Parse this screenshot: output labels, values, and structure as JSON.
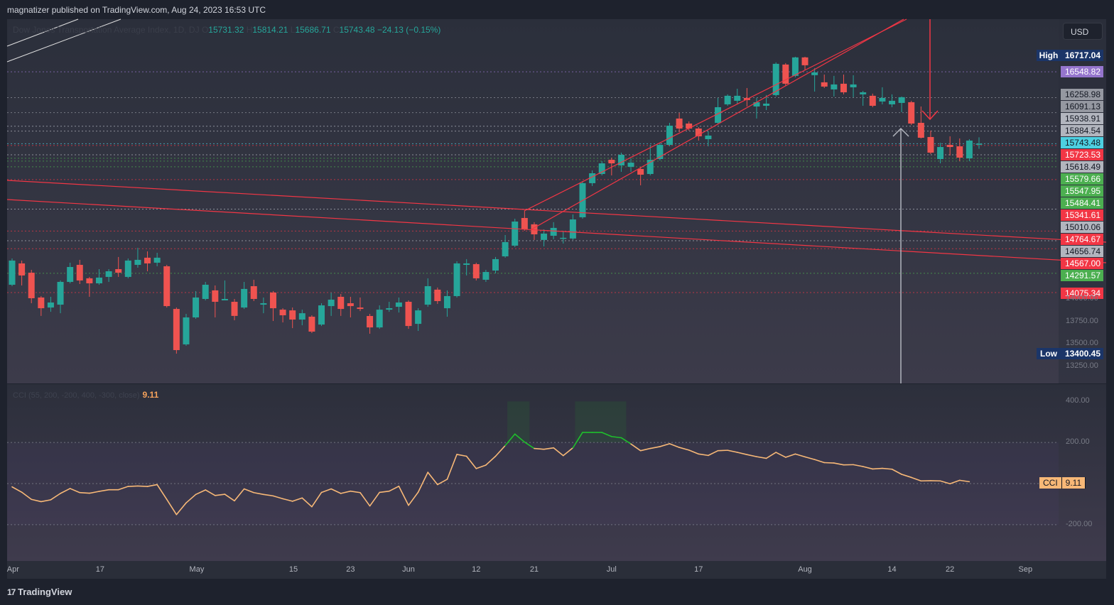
{
  "header": {
    "published": "magnatizer published on TradingView.com, Aug 24, 2023 16:53 UTC"
  },
  "legend": {
    "symbol": "Dow Jones Transportation Average Index, 1D, DJ",
    "o_label": "O",
    "o": "15731.32",
    "h_label": "H",
    "h": "15814.21",
    "l_label": "L",
    "l": "15686.71",
    "c_label": "C",
    "c": "15743.48",
    "change": "−24.13 (−0.15%)"
  },
  "currency": "USD",
  "footer": {
    "brand": "TradingView"
  },
  "colors": {
    "up": "#26a69a",
    "down": "#ef5350",
    "cci": "#f7b877",
    "cci_hi": "#1fbf2c",
    "trend": "#f23645"
  },
  "price_labels": [
    {
      "tag": "High",
      "value": "16717.04",
      "price": 16717.04,
      "bg": "#1b3568",
      "fg": "#ffffff"
    },
    {
      "value": "16548.82",
      "price": 16548.82,
      "bg": "#9575cd",
      "fg": "#ffffff"
    },
    {
      "value": "16258.98",
      "price": 16258.98,
      "bg": "#9598a1",
      "fg": "#131722"
    },
    {
      "value": "16091.13",
      "price": 16091.13,
      "bg": "#9598a1",
      "fg": "#131722"
    },
    {
      "value": "15938.91",
      "price": 15938.91,
      "bg": "#b2b5be",
      "fg": "#131722"
    },
    {
      "value": "15884.54",
      "price": 15884.54,
      "bg": "#b2b5be",
      "fg": "#131722"
    },
    {
      "value": "15743.48",
      "price": 15743.48,
      "bg": "#4dd0e1",
      "fg": "#131722"
    },
    {
      "value": "15723.53",
      "price": 15723.53,
      "bg": "#f23645",
      "fg": "#ffffff"
    },
    {
      "value": "15618.49",
      "price": 15618.49,
      "bg": "#b2b5be",
      "fg": "#131722"
    },
    {
      "value": "15579.66",
      "price": 15579.66,
      "bg": "#4caf50",
      "fg": "#ffffff"
    },
    {
      "value": "15547.95",
      "price": 15547.95,
      "bg": "#4caf50",
      "fg": "#ffffff"
    },
    {
      "value": "15484.41",
      "price": 15484.41,
      "bg": "#4caf50",
      "fg": "#ffffff"
    },
    {
      "value": "15341.61",
      "price": 15341.61,
      "bg": "#f23645",
      "fg": "#ffffff"
    },
    {
      "value": "15010.06",
      "price": 15010.06,
      "bg": "#b2b5be",
      "fg": "#131722"
    },
    {
      "value": "14764.67",
      "price": 14764.67,
      "bg": "#f23645",
      "fg": "#ffffff"
    },
    {
      "value": "14656.74",
      "price": 14656.74,
      "bg": "#b2b5be",
      "fg": "#131722"
    },
    {
      "value": "14567.00",
      "price": 14567.0,
      "bg": "#f23645",
      "fg": "#ffffff"
    },
    {
      "value": "14291.57",
      "price": 14291.57,
      "bg": "#4caf50",
      "fg": "#ffffff"
    },
    {
      "value": "14075.34",
      "price": 14075.34,
      "bg": "#f23645",
      "fg": "#ffffff"
    },
    {
      "tag": "Low",
      "value": "13400.45",
      "price": 13400.45,
      "bg": "#1b3568",
      "fg": "#ffffff"
    }
  ],
  "chart_data": {
    "type": "candlestick",
    "title": "Dow Jones Transportation Average Index, 1D, DJ",
    "price_axis_ticks": [
      "14000.00",
      "13750.00",
      "13500.00",
      "13250.00"
    ],
    "tick_prices": [
      14000,
      13750,
      13500,
      13250
    ],
    "x_ticks": [
      {
        "label": "Apr",
        "bar": 1.1
      },
      {
        "label": "17",
        "bar": 10.1
      },
      {
        "label": "May",
        "bar": 20.1
      },
      {
        "label": "15",
        "bar": 30.1
      },
      {
        "label": "23",
        "bar": 36
      },
      {
        "label": "Jun",
        "bar": 42
      },
      {
        "label": "12",
        "bar": 49
      },
      {
        "label": "21",
        "bar": 55
      },
      {
        "label": "Jul",
        "bar": 63
      },
      {
        "label": "17",
        "bar": 72
      },
      {
        "label": "Aug",
        "bar": 83
      },
      {
        "label": "14",
        "bar": 92
      },
      {
        "label": "22",
        "bar": 98
      },
      {
        "label": "Sep",
        "bar": 105.8
      }
    ],
    "ohlc": [
      [
        14163,
        14457,
        14147,
        14434
      ],
      [
        14402,
        14434,
        14155,
        14267
      ],
      [
        14298,
        14330,
        13956,
        14012
      ],
      [
        14020,
        14036,
        13814,
        13900
      ],
      [
        13908,
        14028,
        13860,
        13964
      ],
      [
        13940,
        14211,
        13844,
        14195
      ],
      [
        14195,
        14410,
        14179,
        14362
      ],
      [
        14386,
        14442,
        14171,
        14211
      ],
      [
        14235,
        14251,
        14028,
        14179
      ],
      [
        14179,
        14338,
        14163,
        14243
      ],
      [
        14251,
        14338,
        14195,
        14314
      ],
      [
        14338,
        14474,
        14251,
        14298
      ],
      [
        14251,
        14457,
        14235,
        14434
      ],
      [
        14386,
        14577,
        14354,
        14442
      ],
      [
        14466,
        14537,
        14314,
        14402
      ],
      [
        14410,
        14521,
        14370,
        14466
      ],
      [
        14370,
        14386,
        13908,
        13924
      ],
      [
        13892,
        13908,
        13391,
        13431
      ],
      [
        13495,
        13837,
        13479,
        13797
      ],
      [
        13797,
        14092,
        13781,
        14020
      ],
      [
        14004,
        14195,
        13988,
        14163
      ],
      [
        14100,
        14155,
        13797,
        13972
      ],
      [
        13988,
        14211,
        13988,
        14004
      ],
      [
        13972,
        14004,
        13765,
        13814
      ],
      [
        13908,
        14195,
        13892,
        14116
      ],
      [
        14147,
        14219,
        13980,
        14004
      ],
      [
        13940,
        14020,
        13844,
        13956
      ],
      [
        14076,
        14092,
        13757,
        13900
      ],
      [
        13884,
        13900,
        13741,
        13821
      ],
      [
        13876,
        13908,
        13677,
        13773
      ],
      [
        13773,
        13884,
        13709,
        13844
      ],
      [
        13805,
        13821,
        13622,
        13638
      ],
      [
        13717,
        13956,
        13701,
        13932
      ],
      [
        13924,
        14076,
        13814,
        13996
      ],
      [
        14028,
        14060,
        13814,
        13892
      ],
      [
        13956,
        14028,
        13797,
        13924
      ],
      [
        13908,
        14020,
        13868,
        13892
      ],
      [
        13813,
        13837,
        13614,
        13685
      ],
      [
        13685,
        13932,
        13669,
        13884
      ],
      [
        13884,
        13972,
        13860,
        13900
      ],
      [
        13916,
        14020,
        13852,
        13964
      ],
      [
        13972,
        13988,
        13669,
        13701
      ],
      [
        13725,
        13900,
        13646,
        13876
      ],
      [
        13940,
        14235,
        13916,
        14147
      ],
      [
        14108,
        14132,
        13948,
        13980
      ],
      [
        13900,
        14100,
        13805,
        14036
      ],
      [
        14036,
        14426,
        14020,
        14402
      ],
      [
        14386,
        14450,
        14267,
        14402
      ],
      [
        14394,
        14410,
        14211,
        14235
      ],
      [
        14219,
        14330,
        14195,
        14306
      ],
      [
        14322,
        14474,
        14290,
        14450
      ],
      [
        14481,
        14720,
        14466,
        14641
      ],
      [
        14601,
        14903,
        14585,
        14871
      ],
      [
        14911,
        14990,
        14768,
        14784
      ],
      [
        14840,
        14864,
        14665,
        14728
      ],
      [
        14665,
        14784,
        14593,
        14736
      ],
      [
        14712,
        14864,
        14673,
        14800
      ],
      [
        14681,
        14768,
        14625,
        14689
      ],
      [
        14681,
        14951,
        14665,
        14895
      ],
      [
        14919,
        15325,
        14903,
        15301
      ],
      [
        15301,
        15444,
        15269,
        15412
      ],
      [
        15404,
        15547,
        15388,
        15523
      ],
      [
        15563,
        15587,
        15388,
        15523
      ],
      [
        15500,
        15643,
        15428,
        15619
      ],
      [
        15484,
        15579,
        15428,
        15531
      ],
      [
        15460,
        15484,
        15277,
        15396
      ],
      [
        15404,
        15730,
        15388,
        15563
      ],
      [
        15571,
        15754,
        15555,
        15730
      ],
      [
        15730,
        15977,
        15714,
        15945
      ],
      [
        16025,
        16089,
        15874,
        15913
      ],
      [
        15969,
        15993,
        15890,
        15913
      ],
      [
        15913,
        15929,
        15778,
        15826
      ],
      [
        15794,
        15882,
        15714,
        15834
      ],
      [
        15977,
        16256,
        15961,
        16152
      ],
      [
        16184,
        16296,
        16168,
        16280
      ],
      [
        16224,
        16359,
        16184,
        16280
      ],
      [
        16256,
        16367,
        16160,
        16232
      ],
      [
        16160,
        16256,
        16025,
        16208
      ],
      [
        16168,
        16288,
        16120,
        16192
      ],
      [
        16288,
        16654,
        16272,
        16638
      ],
      [
        16630,
        16646,
        16391,
        16415
      ],
      [
        16503,
        16717,
        16487,
        16710
      ],
      [
        16710,
        16717,
        16566,
        16622
      ],
      [
        16511,
        16590,
        16327,
        16542
      ],
      [
        16431,
        16518,
        16367,
        16383
      ],
      [
        16351,
        16503,
        16272,
        16407
      ],
      [
        16415,
        16518,
        16296,
        16319
      ],
      [
        16375,
        16510,
        16264,
        16407
      ],
      [
        16296,
        16335,
        16168,
        16319
      ],
      [
        16280,
        16304,
        16152,
        16168
      ],
      [
        16216,
        16375,
        16184,
        16256
      ],
      [
        16184,
        16296,
        16152,
        16224
      ],
      [
        16200,
        16272,
        16096,
        16264
      ],
      [
        16208,
        16224,
        15953,
        15969
      ],
      [
        15977,
        16160,
        15802,
        15810
      ],
      [
        15818,
        15890,
        15627,
        15643
      ],
      [
        15571,
        15754,
        15523,
        15706
      ],
      [
        15730,
        15826,
        15611,
        15706
      ],
      [
        15714,
        15802,
        15547,
        15587
      ],
      [
        15579,
        15794,
        15547,
        15778
      ],
      [
        15731.32,
        15814.21,
        15686.71,
        15743.48
      ]
    ],
    "indicator": {
      "name": "CCI (55, 200, -200, 400, -300, close)",
      "last": "9.11",
      "tag": "CCI",
      "axis_ticks": [
        "400.00",
        "200.00",
        "-200.00"
      ],
      "tick_values": [
        400,
        200,
        -200
      ],
      "upper_band": 200,
      "lower_band": -200,
      "values": [
        -16,
        -42,
        -77,
        -88,
        -79,
        -48,
        -24,
        -44,
        -47,
        -38,
        -30,
        -30,
        -14,
        -12,
        -14,
        -5,
        -77,
        -151,
        -94,
        -53,
        -31,
        -58,
        -52,
        -84,
        -26,
        -44,
        -53,
        -60,
        -74,
        -86,
        -70,
        -113,
        -43,
        -26,
        -48,
        -37,
        -44,
        -109,
        -43,
        -37,
        -13,
        -106,
        -42,
        55,
        -5,
        21,
        142,
        133,
        73,
        90,
        133,
        185,
        241,
        202,
        171,
        167,
        174,
        136,
        174,
        249,
        249,
        249,
        229,
        223,
        193,
        160,
        171,
        180,
        194,
        176,
        163,
        144,
        137,
        160,
        162,
        152,
        141,
        131,
        123,
        152,
        128,
        144,
        130,
        117,
        102,
        100,
        91,
        92,
        83,
        71,
        74,
        70,
        45,
        30,
        13,
        14,
        13,
        -1,
        16,
        9.11
      ]
    }
  }
}
